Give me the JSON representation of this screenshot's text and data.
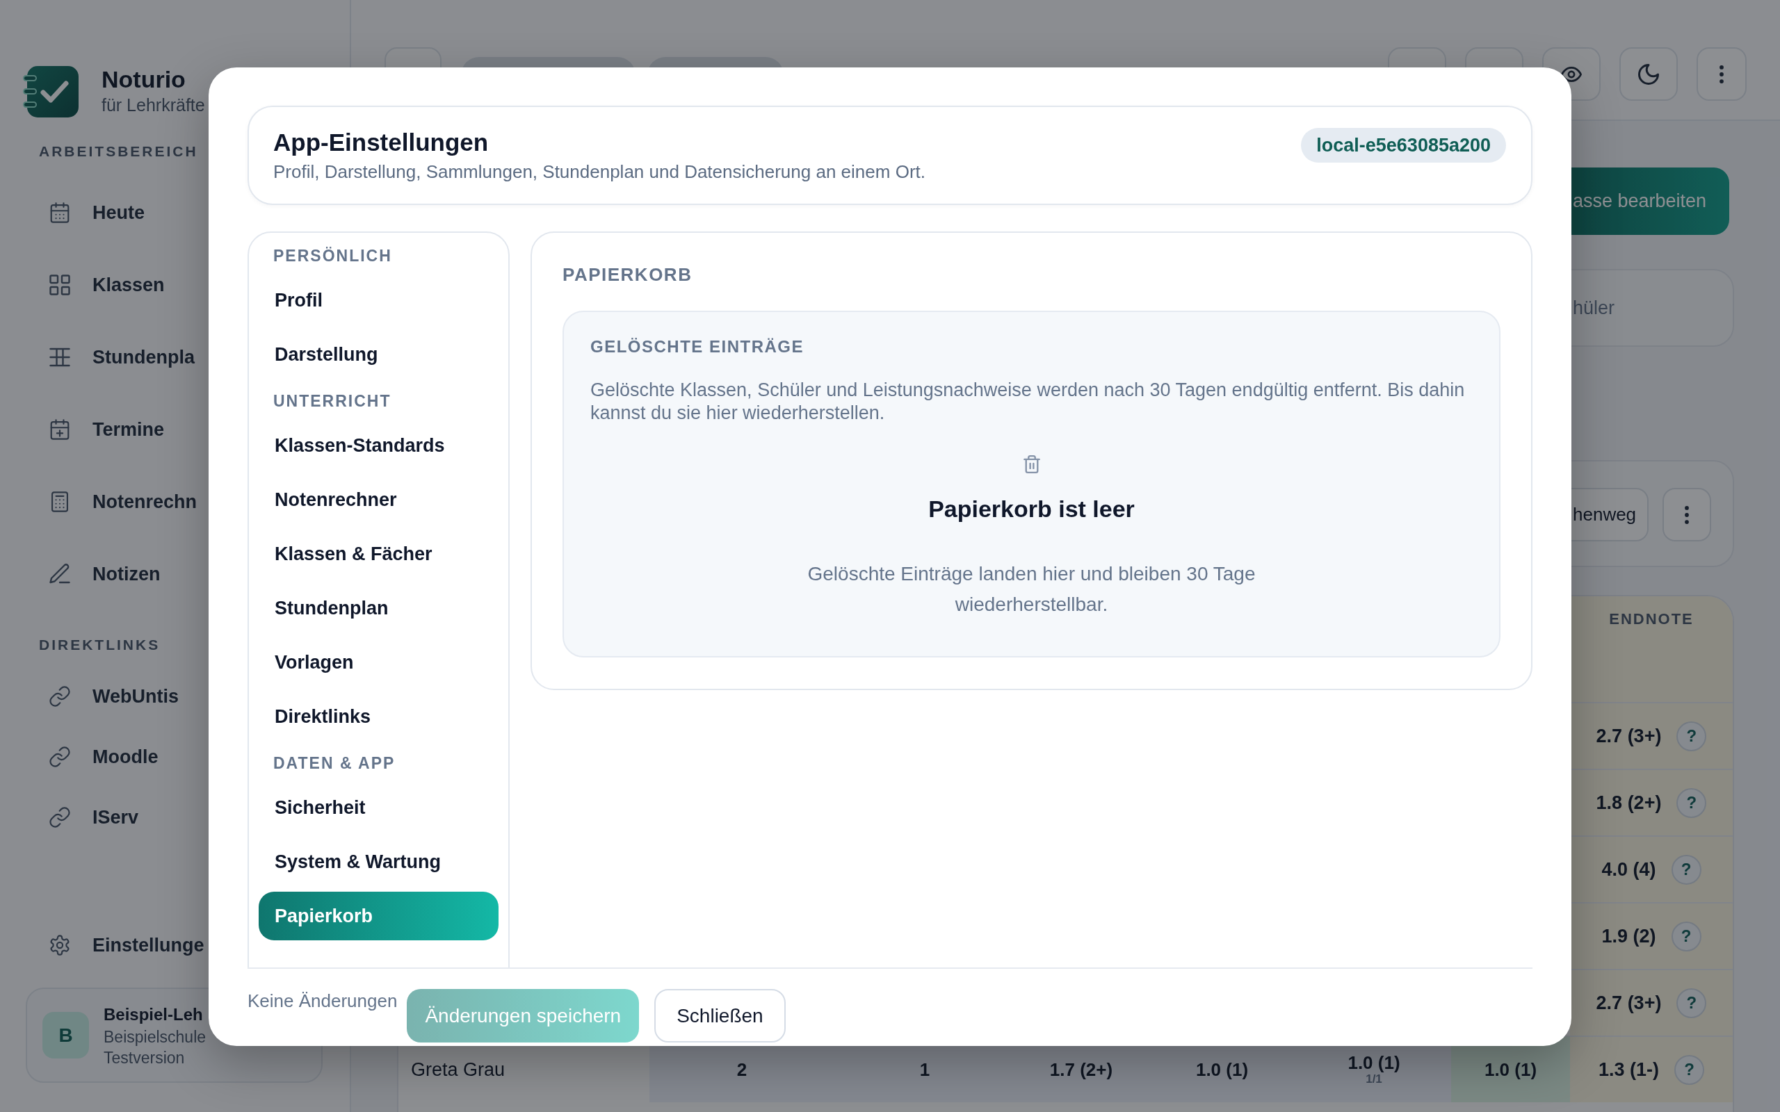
{
  "sidebar": {
    "brand": {
      "name": "Noturio",
      "tagline": "für Lehrkräfte"
    },
    "groups": [
      {
        "label": "ARBEITSBEREICH",
        "items": [
          {
            "label": "Heute",
            "selected": false
          },
          {
            "label": "Klassen",
            "selected": false
          },
          {
            "label": "Stundenpla",
            "selected": false
          },
          {
            "label": "Termine",
            "selected": false
          },
          {
            "label": "Notenrechn",
            "selected": false
          },
          {
            "label": "Notizen",
            "selected": false
          }
        ]
      },
      {
        "label": "DIREKTLINKS",
        "items": [
          {
            "label": "WebUntis"
          },
          {
            "label": "Moodle"
          },
          {
            "label": "IServ"
          }
        ]
      }
    ],
    "settings": {
      "label": "Einstellunge"
    },
    "account": {
      "initial": "B",
      "name": "Beispiel-Leh",
      "school": "Beispielschule",
      "plan": "Testversion"
    }
  },
  "class_view": {
    "edit_button": "asse bearbeiten",
    "students_card": "hüler",
    "action_button": "henweg",
    "grades": {
      "endnote_header": "ENDNOTE",
      "rows": [
        {
          "endnote": "2.7 (3+)",
          "help": "?"
        },
        {
          "endnote": "1.8 (2+)",
          "help": "?"
        },
        {
          "endnote": "4.0 (4)",
          "help": "?"
        },
        {
          "endnote": "1.9 (2)",
          "help": "?"
        },
        {
          "endnote": "2.7 (3+)",
          "help": "?"
        },
        {
          "name": "Greta Grau",
          "cells": [
            {
              "kind": "grade",
              "text": "2"
            },
            {
              "kind": "grade",
              "text": "1"
            },
            {
              "kind": "grade",
              "text": "1.7 (2+)"
            },
            {
              "kind": "grade",
              "text": "1.0 (1)"
            },
            {
              "kind": "grade",
              "text": "1.0 (1)",
              "sub": "1/1"
            },
            {
              "kind": "final",
              "text": "1.0 (1)"
            }
          ],
          "endnote": "1.3 (1-)",
          "help": "?"
        }
      ]
    }
  },
  "settings_dialog": {
    "header": {
      "title": "App-Einstellungen",
      "subtitle": "Profil, Darstellung, Sammlungen, Stundenplan und Datensicherung an einem Ort.",
      "badge": "local-e5e63085a200"
    },
    "nav": [
      {
        "label": "PERSÖNLICH",
        "items": [
          {
            "label": "Profil",
            "selected": false
          },
          {
            "label": "Darstellung",
            "selected": false
          }
        ]
      },
      {
        "label": "UNTERRICHT",
        "items": [
          {
            "label": "Klassen-Standards",
            "selected": false
          },
          {
            "label": "Notenrechner",
            "selected": false
          },
          {
            "label": "Klassen & Fächer",
            "selected": false
          },
          {
            "label": "Stundenplan",
            "selected": false
          },
          {
            "label": "Vorlagen",
            "selected": false
          },
          {
            "label": "Direktlinks",
            "selected": false
          }
        ]
      },
      {
        "label": "DATEN & APP",
        "items": [
          {
            "label": "Sicherheit",
            "selected": false
          },
          {
            "label": "System & Wartung",
            "selected": false
          },
          {
            "label": "Papierkorb",
            "selected": true
          }
        ]
      }
    ],
    "section": {
      "title": "PAPIERKORB",
      "card": {
        "title": "GELÖSCHTE EINTRÄGE",
        "text": "Gelöschte Klassen, Schüler und Leistungsnachweise werden nach 30 Tagen endgültig entfernt. Bis dahin kannst du sie hier wiederherstellen.",
        "empty_title": "Papierkorb ist leer",
        "empty_text": "Gelöschte Einträge landen hier und bleiben 30 Tage wiederherstellbar."
      }
    },
    "footer": {
      "status": "Keine Änderungen",
      "buttons": [
        {
          "label": "Änderungen speichern",
          "kind": "primary",
          "disabled": true
        },
        {
          "label": "Schließen",
          "kind": "secondary",
          "disabled": false
        }
      ]
    }
  }
}
